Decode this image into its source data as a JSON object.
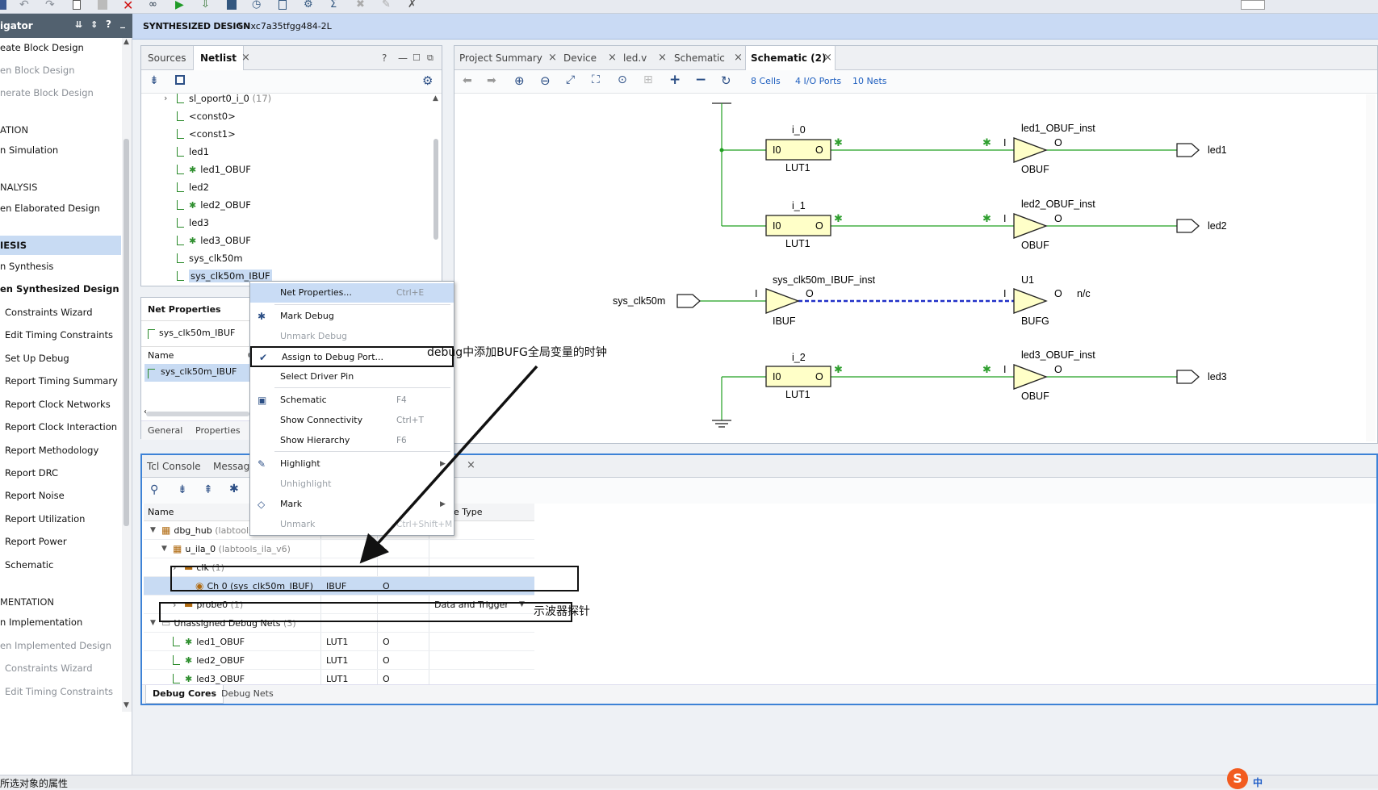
{
  "toolbar": {
    "icons": [
      "save-icon",
      "undo-icon",
      "redo-icon",
      "copy-icon",
      "paste-icon",
      "delete-icon",
      "binoculars-icon",
      "run-icon",
      "download-icon",
      "program-icon",
      "timer-icon",
      "report-icon",
      "settings-icon",
      "sigma-icon",
      "tool-icon",
      "pen-icon",
      "debug-cross-icon"
    ]
  },
  "flow_navigator": {
    "title": "igator",
    "title_icons": [
      "collapse-icon",
      "expand-icon",
      "help-icon",
      "minimize-icon"
    ],
    "items": [
      {
        "label": "eate Block Design",
        "type": "link"
      },
      {
        "label": "en Block Design",
        "type": "disabled"
      },
      {
        "label": "nerate Block Design",
        "type": "disabled"
      },
      {
        "label": "ATION",
        "type": "section"
      },
      {
        "label": "n Simulation",
        "type": "link"
      },
      {
        "label": "NALYSIS",
        "type": "section"
      },
      {
        "label": "en Elaborated Design",
        "type": "link"
      },
      {
        "label": "IESIS",
        "type": "section-active"
      },
      {
        "label": "n Synthesis",
        "type": "link"
      },
      {
        "label": "en Synthesized Design",
        "type": "bold"
      },
      {
        "label": "Constraints Wizard",
        "type": "sub"
      },
      {
        "label": "Edit Timing Constraints",
        "type": "sub"
      },
      {
        "label": "Set Up Debug",
        "type": "sub"
      },
      {
        "label": "Report Timing Summary",
        "type": "sub"
      },
      {
        "label": "Report Clock Networks",
        "type": "sub"
      },
      {
        "label": "Report Clock Interaction",
        "type": "sub"
      },
      {
        "label": "Report Methodology",
        "type": "sub"
      },
      {
        "label": "Report DRC",
        "type": "sub"
      },
      {
        "label": "Report Noise",
        "type": "sub"
      },
      {
        "label": "Report Utilization",
        "type": "sub"
      },
      {
        "label": "Report Power",
        "type": "sub"
      },
      {
        "label": "Schematic",
        "type": "sub"
      },
      {
        "label": "MENTATION",
        "type": "section"
      },
      {
        "label": "n Implementation",
        "type": "link"
      },
      {
        "label": "en Implemented Design",
        "type": "disabled"
      },
      {
        "label": "Constraints Wizard",
        "type": "sub-disabled"
      },
      {
        "label": "Edit Timing Constraints",
        "type": "sub-disabled"
      }
    ]
  },
  "design_header": {
    "title": "SYNTHESIZED DESIGN",
    "subtitle": " * - xc7a35tfgg484-2L"
  },
  "netlist_panel": {
    "tabs": [
      "Sources",
      "Netlist"
    ],
    "icons": [
      "help-icon",
      "minimize-icon",
      "maximize-icon",
      "float-icon",
      "collapse-all-icon",
      "schematic-icon",
      "gear-icon"
    ],
    "tree": [
      {
        "label": "sl_oport0_i_0",
        "suffix": " (17)",
        "kind": "bus"
      },
      {
        "label": "<const0>",
        "kind": "net"
      },
      {
        "label": "<const1>",
        "kind": "net"
      },
      {
        "label": "led1",
        "kind": "net"
      },
      {
        "label": "led1_OBUF",
        "kind": "debug"
      },
      {
        "label": "led2",
        "kind": "net"
      },
      {
        "label": "led2_OBUF",
        "kind": "debug"
      },
      {
        "label": "led3",
        "kind": "net"
      },
      {
        "label": "led3_OBUF",
        "kind": "debug"
      },
      {
        "label": "sys_clk50m",
        "kind": "net"
      },
      {
        "label": "sys_clk50m_IBUF",
        "kind": "selected"
      }
    ]
  },
  "net_properties": {
    "title": "Net Properties",
    "net": "sys_clk50m_IBUF",
    "name_header": "Name",
    "col2_header": "C",
    "value": "sys_clk50m_IBUF",
    "tabs": [
      "General",
      "Properties"
    ]
  },
  "editor": {
    "tabs": [
      "Project Summary",
      "Device",
      "led.v",
      "Schematic",
      "Schematic (2)"
    ],
    "cells_link": "8 Cells",
    "ports_link": "4 I/O Ports",
    "nets_link": "10 Nets",
    "icons": [
      "back-icon",
      "forward-icon",
      "zoom-in-icon",
      "zoom-out-icon",
      "fit-icon",
      "zoom-area-icon",
      "autofit-icon",
      "expand-cell-icon",
      "add-icon",
      "remove-icon",
      "refresh-icon"
    ]
  },
  "schematic": {
    "luts": [
      {
        "inst": "i_0",
        "type": "LUT1",
        "pin_in": "I0",
        "pin_out": "O"
      },
      {
        "inst": "i_1",
        "type": "LUT1",
        "pin_in": "I0",
        "pin_out": "O"
      },
      {
        "inst": "i_2",
        "type": "LUT1",
        "pin_in": "I0",
        "pin_out": "O"
      }
    ],
    "obufs": [
      {
        "inst": "led1_OBUF_inst",
        "type": "OBUF",
        "pin_in": "I",
        "pin_out": "O",
        "port": "led1"
      },
      {
        "inst": "led2_OBUF_inst",
        "type": "OBUF",
        "pin_in": "I",
        "pin_out": "O",
        "port": "led2"
      },
      {
        "inst": "led3_OBUF_inst",
        "type": "OBUF",
        "pin_in": "I",
        "pin_out": "O",
        "port": "led3"
      }
    ],
    "ibuf": {
      "inst": "sys_clk50m_IBUF_inst",
      "type": "IBUF",
      "pin_in": "I",
      "pin_out": "O",
      "port": "sys_clk50m"
    },
    "bufg": {
      "inst": "U1",
      "type": "BUFG",
      "pin_in": "I",
      "pin_out": "O",
      "nc": "n/c"
    }
  },
  "context_menu": {
    "items": [
      {
        "label": "Net Properties...",
        "shortcut": "Ctrl+E",
        "state": "highlight",
        "icon": ""
      },
      {
        "label": "Mark Debug",
        "shortcut": "",
        "state": "normal",
        "icon": "bug-icon"
      },
      {
        "label": "Unmark Debug",
        "shortcut": "",
        "state": "disabled",
        "icon": ""
      },
      {
        "label": "Assign to Debug Port...",
        "shortcut": "",
        "state": "boxed",
        "icon": "assign-debug-icon"
      },
      {
        "label": "Select Driver Pin",
        "shortcut": "",
        "state": "normal",
        "icon": ""
      },
      {
        "label": "Schematic",
        "shortcut": "F4",
        "state": "normal",
        "icon": "schematic-icon"
      },
      {
        "label": "Show Connectivity",
        "shortcut": "Ctrl+T",
        "state": "normal",
        "icon": ""
      },
      {
        "label": "Show Hierarchy",
        "shortcut": "F6",
        "state": "normal",
        "icon": ""
      },
      {
        "label": "Highlight",
        "shortcut": "",
        "state": "submenu",
        "icon": "highlight-icon"
      },
      {
        "label": "Unhighlight",
        "shortcut": "",
        "state": "disabled",
        "icon": ""
      },
      {
        "label": "Mark",
        "shortcut": "",
        "state": "submenu",
        "icon": "mark-icon"
      },
      {
        "label": "Unmark",
        "shortcut": "Ctrl+Shift+M",
        "state": "disabled",
        "icon": ""
      }
    ]
  },
  "debug_panel": {
    "tabs": [
      "Tcl Console",
      "Message"
    ],
    "bottom_tabs": [
      "Debug Cores",
      "Debug Nets"
    ],
    "columns": [
      "Name",
      "",
      "",
      "e Type"
    ],
    "icons": [
      "search-icon",
      "collapse-all-icon",
      "expand-all-icon",
      "bug-icon"
    ],
    "rows": [
      {
        "indent": 0,
        "name": "dbg_hub",
        "suffix": " (labtools_",
        "c2": "",
        "c3": "",
        "c4": "",
        "kind": "core"
      },
      {
        "indent": 1,
        "name": "u_ila_0",
        "suffix": " (labtools_ila_v6)",
        "c2": "",
        "c3": "",
        "c4": "",
        "kind": "core"
      },
      {
        "indent": 2,
        "name": "clk",
        "suffix": " (1)",
        "c2": "",
        "c3": "",
        "c4": "",
        "kind": "port"
      },
      {
        "indent": 3,
        "name": "Ch 0 (sys_clk50m_IBUF)",
        "suffix": "",
        "c2": "IBUF",
        "c3": "O",
        "c4": "",
        "kind": "selected"
      },
      {
        "indent": 2,
        "name": "probe0",
        "suffix": " (1)",
        "c2": "",
        "c3": "",
        "c4": "Data and Trigger",
        "kind": "port"
      },
      {
        "indent": 0,
        "name": "Unassigned Debug Nets",
        "suffix": " (3)",
        "c2": "",
        "c3": "",
        "c4": "",
        "kind": "group"
      },
      {
        "indent": 1,
        "name": "led1_OBUF",
        "suffix": "",
        "c2": "LUT1",
        "c3": "O",
        "c4": "",
        "kind": "debugnet"
      },
      {
        "indent": 1,
        "name": "led2_OBUF",
        "suffix": "",
        "c2": "LUT1",
        "c3": "O",
        "c4": "",
        "kind": "debugnet"
      },
      {
        "indent": 1,
        "name": "led3_OBUF",
        "suffix": "",
        "c2": "LUT1",
        "c3": "O",
        "c4": "",
        "kind": "debugnet"
      }
    ]
  },
  "annotations": {
    "arrow_text": "debug中添加BUFG全局变量的时钟",
    "probe_text": "示波器探针"
  },
  "status_bar": {
    "text": "所选对象的属性",
    "ime_label": "中"
  }
}
